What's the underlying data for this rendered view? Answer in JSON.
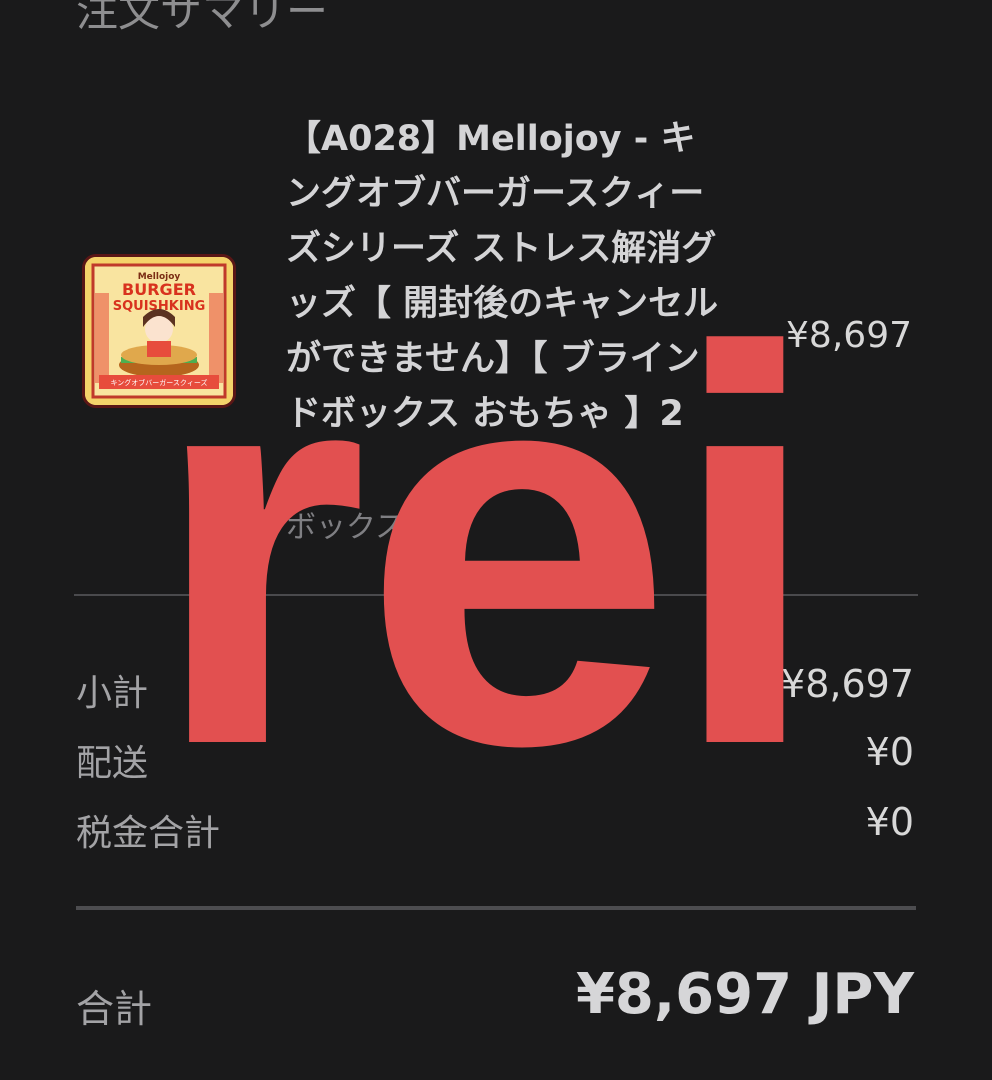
{
  "header": {
    "title": "注文サマリー"
  },
  "product": {
    "name": "【A028】Mellojoy - キングオブバーガースクィーズシリーズ ストレス解消グッズ【 開封後のキャンセルができません】【 ブラインドボックス おもちゃ 】2",
    "variant": "ボックス",
    "price": "¥8,697",
    "thumbnail": {
      "brand": "Mellojoy",
      "title_line1": "BURGER",
      "title_line2": "SQUISHKING",
      "caption": "キングオブバーガースクィーズ"
    }
  },
  "summary": {
    "rows": [
      {
        "label": "小計",
        "value": "¥8,697"
      },
      {
        "label": "配送",
        "value": "¥0"
      },
      {
        "label": "税金合計",
        "value": "¥0"
      }
    ]
  },
  "total": {
    "label": "合計",
    "value": "¥8,697 JPY"
  },
  "watermark": {
    "text": "rei",
    "color": "#e25050"
  },
  "colors": {
    "background": "#1a1a1b",
    "text_primary": "#d8d8d8",
    "text_secondary": "#a3a3a6",
    "divider": "#4a4a4d"
  }
}
